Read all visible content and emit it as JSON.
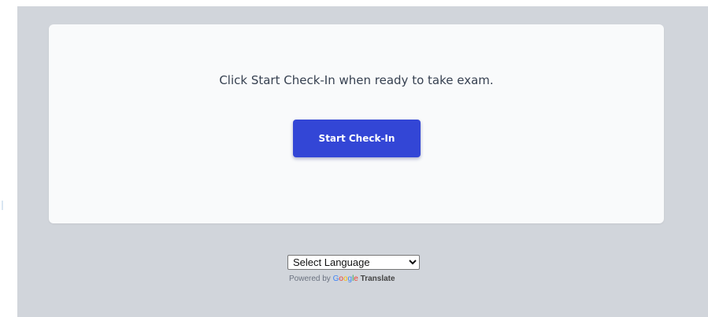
{
  "card": {
    "instruction": "Click Start Check-In when ready to take exam.",
    "start_button_label": "Start Check-In"
  },
  "translate": {
    "selected_language": "Select Language",
    "powered_by": "Powered by",
    "google_letters": [
      "G",
      "o",
      "o",
      "g",
      "l",
      "e"
    ],
    "translate_word": "Translate"
  },
  "colors": {
    "page_background": "#d1d5db",
    "card_background": "#f9fafb",
    "button_background": "#3346d6",
    "text": "#374151"
  }
}
